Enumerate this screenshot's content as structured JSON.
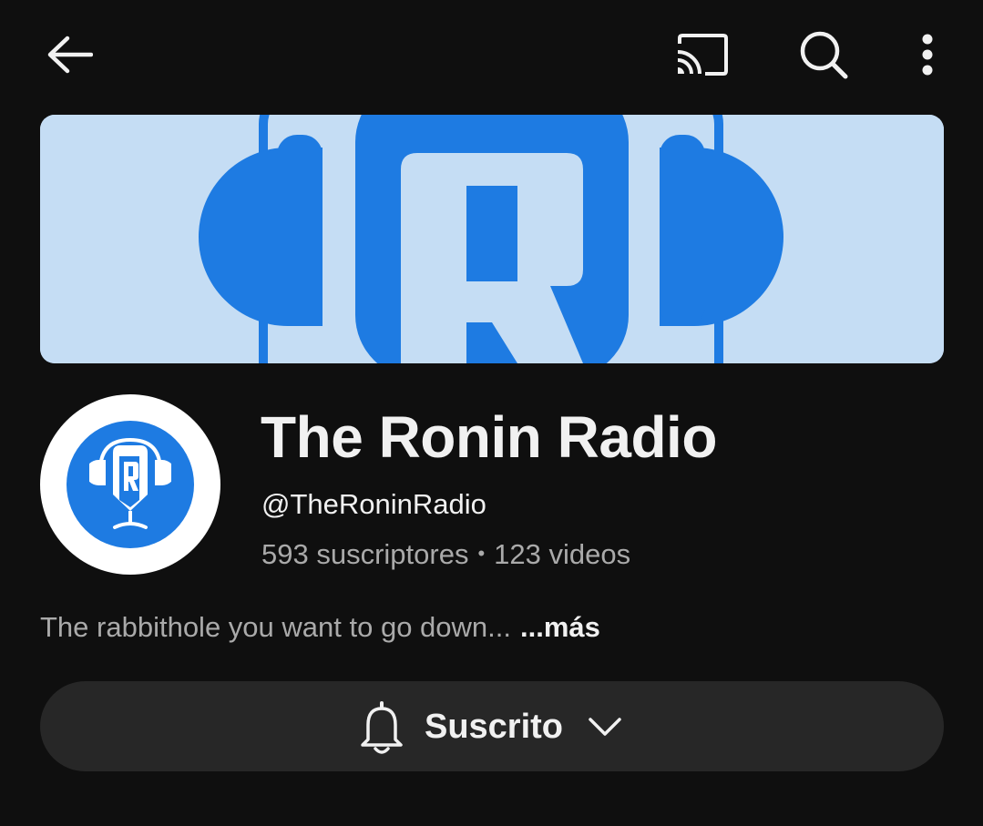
{
  "topbar": {
    "icons": [
      "back-arrow-icon",
      "cast-icon",
      "search-icon",
      "more-vert-icon"
    ]
  },
  "banner": {
    "colors": {
      "background": "#c5ddf4",
      "brand": "#1e7be2"
    },
    "logo_letter": "R"
  },
  "channel": {
    "name": "The Ronin Radio",
    "handle": "@TheRoninRadio",
    "subscribers": "593 suscriptores",
    "separator": "•",
    "videos": "123 videos",
    "description": "The rabbithole you want to go down...",
    "more_label": "...más"
  },
  "subscribe": {
    "label": "Suscrito",
    "icon": "bell-icon",
    "dropdown_icon": "chevron-down-icon"
  },
  "theme": {
    "background": "#0f0f0f",
    "button_bg": "#272727",
    "text_primary": "#f1f1f1",
    "text_secondary": "#aaaaaa"
  }
}
